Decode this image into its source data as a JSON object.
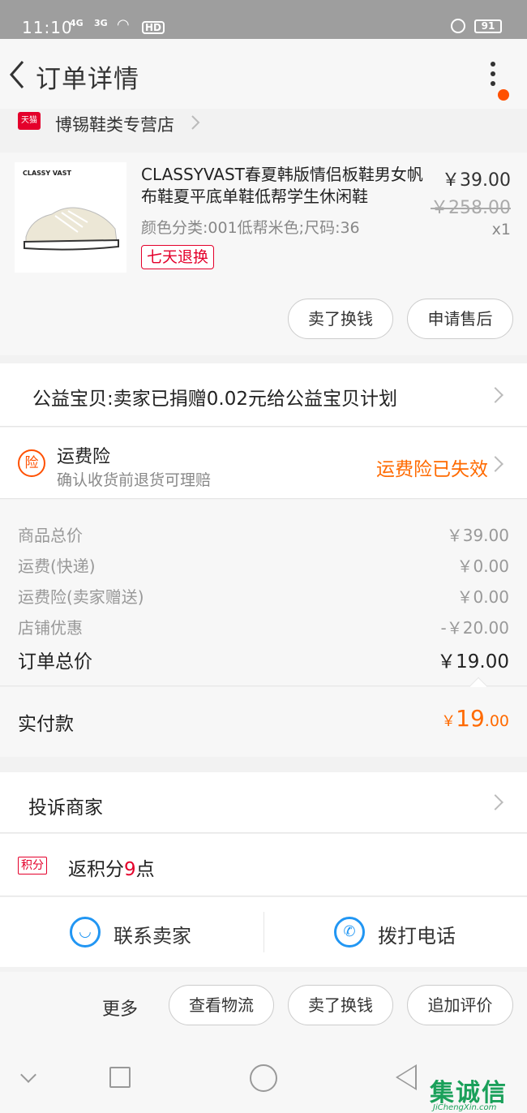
{
  "status": {
    "time": "11:10",
    "sig1": "4G",
    "sig2": "3G",
    "hd": "HD",
    "battery": "91"
  },
  "nav": {
    "title": "订单详情"
  },
  "shop": {
    "badge": "天猫",
    "name": "博锡鞋类专营店"
  },
  "product": {
    "brand": "CLASSY VAST",
    "title": "CLASSYVAST春夏韩版情侣板鞋男女帆布鞋夏平底单鞋低帮学生休闲鞋",
    "spec": "颜色分类:001低帮米色;尺码:36",
    "tag": "七天退换",
    "price_now": "￥39.00",
    "price_old": "￥258.00",
    "qty": "x1",
    "btn_resell": "卖了换钱",
    "btn_aftersale": "申请售后"
  },
  "charity": {
    "text": "公益宝贝:卖家已捐赠0.02元给公益宝贝计划"
  },
  "insurance": {
    "icon": "险",
    "title": "运费险",
    "subtitle": "确认收货前退货可理赔",
    "status": "运费险已失效"
  },
  "pricelist": {
    "rows": [
      {
        "label": "商品总价",
        "value": "￥39.00"
      },
      {
        "label": "运费(快递)",
        "value": "￥0.00"
      },
      {
        "label": "运费险(卖家赠送)",
        "value": "￥0.00"
      },
      {
        "label": "店铺优惠",
        "value": "-￥20.00"
      }
    ],
    "total_label": "订单总价",
    "total_value": "￥19.00"
  },
  "paid": {
    "label": "实付款",
    "currency": "￥",
    "int": "19",
    "dec": ".00"
  },
  "complain": {
    "label": "投诉商家"
  },
  "points": {
    "badge": "积分",
    "prefix": "返积分",
    "num": "9",
    "suffix": "点"
  },
  "contact": {
    "seller": "联系卖家",
    "phone": "拨打电话"
  },
  "actions": {
    "more": "更多",
    "logistics": "查看物流",
    "resell": "卖了换钱",
    "review": "追加评价"
  },
  "watermark": {
    "logo": "集诚信",
    "url": "JiChengXin.com"
  },
  "colors": {
    "accent": "#ff6a00",
    "tmall": "#e4002b",
    "blue": "#2196f3"
  }
}
